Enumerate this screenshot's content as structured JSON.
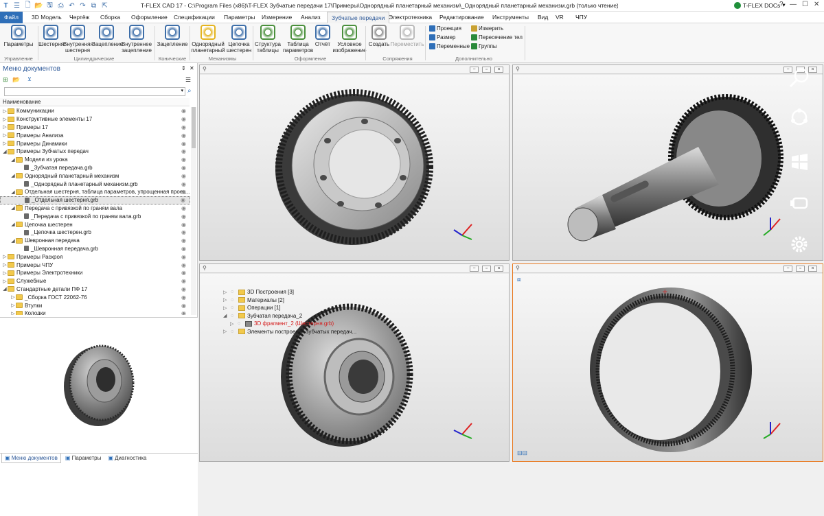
{
  "app": {
    "title": "T-FLEX CAD 17 - C:\\Program Files (x86)\\T-FLEX Зубчатые передачи 17\\Примеры\\Однорядный планетарный механизм\\_Однорядный планетарный механизм.grb (только чтение)",
    "docs_label": "T-FLEX DOCs"
  },
  "menu": [
    "Файл",
    "3D Модель",
    "Чертёж",
    "Сборка",
    "Оформление",
    "Спецификации",
    "Параметры",
    "Измерение",
    "Анализ",
    "Зубчатые передачи",
    "Электротехника",
    "Редактирование",
    "Инструменты",
    "Вид",
    "VR",
    "ЧПУ"
  ],
  "menu_active": "Зубчатые передачи",
  "ribbon": {
    "buttons": [
      {
        "label": "Параметры",
        "icon": "settings-icon"
      },
      {
        "label": "Шестерня",
        "icon": "gear-icon"
      },
      {
        "label": "Внутренняя шестерня",
        "icon": "internal-gear-icon"
      },
      {
        "label": "Зацепление",
        "icon": "mesh-icon"
      },
      {
        "label": "Внутреннее зацепление",
        "icon": "internal-mesh-icon"
      },
      {
        "label": "Зацепление",
        "icon": "bevel-mesh-icon"
      },
      {
        "label": "Однорядный планетарный",
        "icon": "planetary-icon"
      },
      {
        "label": "Цепочка шестерен",
        "icon": "chain-icon"
      },
      {
        "label": "Структура таблицы",
        "icon": "table-structure-icon"
      },
      {
        "label": "Таблица параметров",
        "icon": "table-icon"
      },
      {
        "label": "Отчёт",
        "icon": "report-icon"
      },
      {
        "label": "Условное изображение",
        "icon": "symbol-icon"
      },
      {
        "label": "Создать",
        "icon": "create-mate-icon"
      },
      {
        "label": "Переместить",
        "icon": "move-mate-icon"
      }
    ],
    "small": [
      "Проекция",
      "Размер",
      "Переменные",
      "Измерить",
      "Пересечение тел",
      "Группы"
    ],
    "groups": [
      "Управление",
      "Цилиндрические",
      "Конические",
      "Механизмы",
      "Оформление",
      "Сопряжения",
      "Дополнительно"
    ]
  },
  "panel": {
    "title": "Меню документов",
    "column": "Наименование",
    "tree": [
      {
        "label": "Коммуникации",
        "level": 0,
        "type": "folder",
        "exp": "▷"
      },
      {
        "label": "Конструктивные элементы 17",
        "level": 0,
        "type": "folder",
        "exp": "▷"
      },
      {
        "label": "Примеры 17",
        "level": 0,
        "type": "folder",
        "exp": "▷"
      },
      {
        "label": "Примеры Анализа",
        "level": 0,
        "type": "folder",
        "exp": "▷"
      },
      {
        "label": "Примеры Динамики",
        "level": 0,
        "type": "folder",
        "exp": "▷"
      },
      {
        "label": "Примеры Зубчатых передач",
        "level": 0,
        "type": "folder",
        "exp": "◢"
      },
      {
        "label": "Модели из урока",
        "level": 1,
        "type": "folder",
        "exp": "◢"
      },
      {
        "label": "_Зубчатая передача.grb",
        "level": 2,
        "type": "file",
        "exp": ""
      },
      {
        "label": "Однорядный планетарный механизм",
        "level": 1,
        "type": "folder",
        "exp": "◢"
      },
      {
        "label": "_Однорядный планетарный механизм.grb",
        "level": 2,
        "type": "file",
        "exp": ""
      },
      {
        "label": "Отдельная шестерня, таблица параметров, упрощенная проек...",
        "level": 1,
        "type": "folder",
        "exp": "◢"
      },
      {
        "label": "_Отдельная шестерня.grb",
        "level": 2,
        "type": "file",
        "exp": "",
        "selected": true
      },
      {
        "label": "Передача с привязкой по граням вала",
        "level": 1,
        "type": "folder",
        "exp": "◢"
      },
      {
        "label": "_Передача с привязкой по граням вала.grb",
        "level": 2,
        "type": "file",
        "exp": ""
      },
      {
        "label": "Цепочка шестерен",
        "level": 1,
        "type": "folder",
        "exp": "◢"
      },
      {
        "label": "_Цепочка шестерен.grb",
        "level": 2,
        "type": "file",
        "exp": ""
      },
      {
        "label": "Шевронная передача",
        "level": 1,
        "type": "folder",
        "exp": "◢"
      },
      {
        "label": "_Шевронная передача.grb",
        "level": 2,
        "type": "file",
        "exp": ""
      },
      {
        "label": "Примеры Раскроя",
        "level": 0,
        "type": "folder",
        "exp": "▷"
      },
      {
        "label": "Примеры ЧПУ",
        "level": 0,
        "type": "folder",
        "exp": "▷"
      },
      {
        "label": "Примеры Электротехники",
        "level": 0,
        "type": "folder",
        "exp": "▷"
      },
      {
        "label": "Служебные",
        "level": 0,
        "type": "folder",
        "exp": "▷"
      },
      {
        "label": "Стандартные детали ПФ 17",
        "level": 0,
        "type": "folder",
        "exp": "◢"
      },
      {
        "label": "_Сборка ГОСТ 22062-76",
        "level": 1,
        "type": "folder",
        "exp": "▷"
      },
      {
        "label": "Втулки",
        "level": 1,
        "type": "folder",
        "exp": "▷"
      },
      {
        "label": "Колодки",
        "level": 1,
        "type": "folder",
        "exp": "▷"
      }
    ],
    "tabs": [
      "Меню документов",
      "Параметры",
      "Диагностика"
    ]
  },
  "model_tree": [
    {
      "label": "3D Построения [3]",
      "level": 0,
      "exp": "▷"
    },
    {
      "label": "Материалы [2]",
      "level": 0,
      "exp": "▷"
    },
    {
      "label": "Операции [1]",
      "level": 0,
      "exp": "▷"
    },
    {
      "label": "Зубчатая передача_2",
      "level": 0,
      "exp": "◢"
    },
    {
      "label": "3D фрагмент_2 (Шестерня.grb)",
      "level": 1,
      "exp": "▷",
      "red": true
    },
    {
      "label": "Элементы построения зубчатых передач...",
      "level": 0,
      "exp": "▷"
    }
  ],
  "colors": {
    "accent": "#2f6fb8",
    "active_border": "#e8781f",
    "red": "#d42020"
  }
}
